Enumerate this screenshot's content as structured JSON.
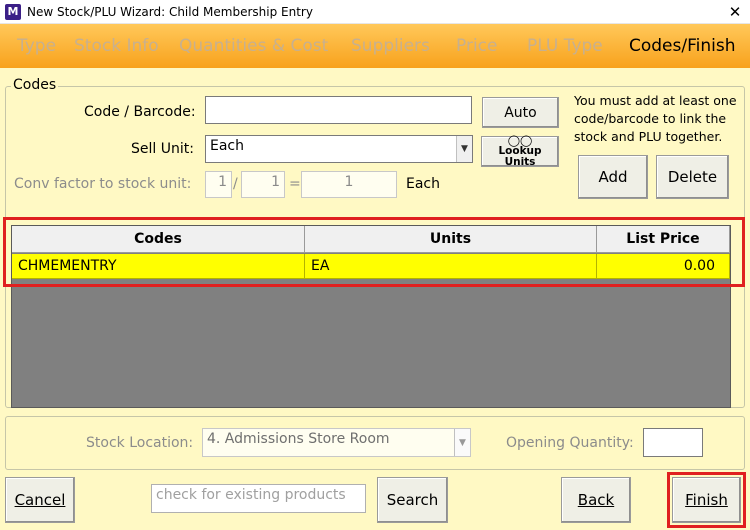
{
  "window": {
    "title": "New Stock/PLU Wizard: Child Membership Entry",
    "app_icon_text": "M",
    "close_symbol": "✕"
  },
  "tabs": [
    {
      "label": "Type",
      "active": false
    },
    {
      "label": "Stock Info",
      "active": false
    },
    {
      "label": "Quantities & Cost",
      "active": false
    },
    {
      "label": "Suppliers",
      "active": false
    },
    {
      "label": "Price",
      "active": false
    },
    {
      "label": "PLU Type",
      "active": false
    },
    {
      "label": "Codes/Finish",
      "active": true
    }
  ],
  "codes_group": {
    "legend": "Codes",
    "code_label": "Code / Barcode:",
    "code_value": "",
    "auto_button": "Auto",
    "help_text": "You must add at least one code/barcode to link the stock and PLU together.",
    "sell_unit_label": "Sell Unit:",
    "sell_unit_value": "Each",
    "lookup_units_button": "Lookup Units",
    "lookup_icon": "glasses-icon",
    "conv_label": "Conv factor to stock unit:",
    "conv_numerator": "1",
    "conv_slash": "/",
    "conv_denominator": "1",
    "conv_equals": "=",
    "conv_result": "1",
    "conv_unit": "Each",
    "add_button": "Add",
    "delete_button": "Delete"
  },
  "grid": {
    "columns": [
      "Codes",
      "Units",
      "List Price"
    ],
    "rows": [
      {
        "code": "CHMEMENTRY",
        "unit": "EA",
        "price": "0.00"
      }
    ]
  },
  "stock_location": {
    "label": "Stock Location:",
    "value": "4. Admissions Store Room",
    "opening_qty_label": "Opening Quantity:",
    "opening_qty_value": ""
  },
  "footer": {
    "cancel_button": "Cancel",
    "search_placeholder": "check for existing products",
    "search_button": "Search",
    "back_button": "Back",
    "finish_button": "Finish"
  },
  "colors": {
    "tab_bar_top": "#ffc85a",
    "tab_bar_bottom": "#f8a21c",
    "panel_bg": "#fff9c4",
    "selected_row": "#ffff00",
    "highlight_border": "#e02020"
  }
}
